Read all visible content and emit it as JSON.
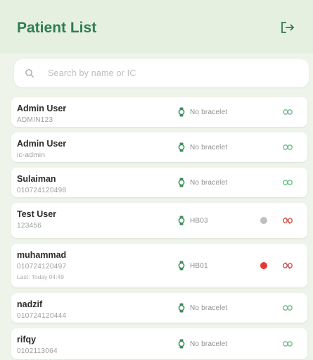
{
  "header": {
    "title": "Patient List",
    "logout_icon": "logout-icon"
  },
  "search": {
    "placeholder": "Search by name or IC",
    "icon": "search-icon"
  },
  "colors": {
    "accent": "#2f7d4f",
    "linked": "#6fbf8b",
    "unlinked": "#d9534f",
    "dot_grey": "#bfbfbf",
    "dot_red": "#e53935"
  },
  "patients": [
    {
      "name": "Admin User",
      "ic": "ADMIN123",
      "last": "",
      "status": "No bracelet",
      "indicator": "",
      "link": "linked"
    },
    {
      "name": "Admin User",
      "ic": "ic-admin",
      "last": "",
      "status": "No bracelet",
      "indicator": "",
      "link": "linked"
    },
    {
      "name": "Sulaiman",
      "ic": "010724120498",
      "last": "",
      "status": "No bracelet",
      "indicator": "",
      "link": "linked"
    },
    {
      "name": "Test User",
      "ic": "123456",
      "last": "",
      "status": "HB03",
      "indicator": "grey",
      "link": "unlinked"
    },
    {
      "name": "muhammad",
      "ic": "010724120497",
      "last": "Last: Today 04:49",
      "status": "HB01",
      "indicator": "red",
      "link": "unlinked"
    },
    {
      "name": "nadzif",
      "ic": "010724120444",
      "last": "",
      "status": "No bracelet",
      "indicator": "",
      "link": "linked"
    },
    {
      "name": "rifqy",
      "ic": "0102113064",
      "last": "",
      "status": "No bracelet",
      "indicator": "",
      "link": "linked"
    }
  ]
}
